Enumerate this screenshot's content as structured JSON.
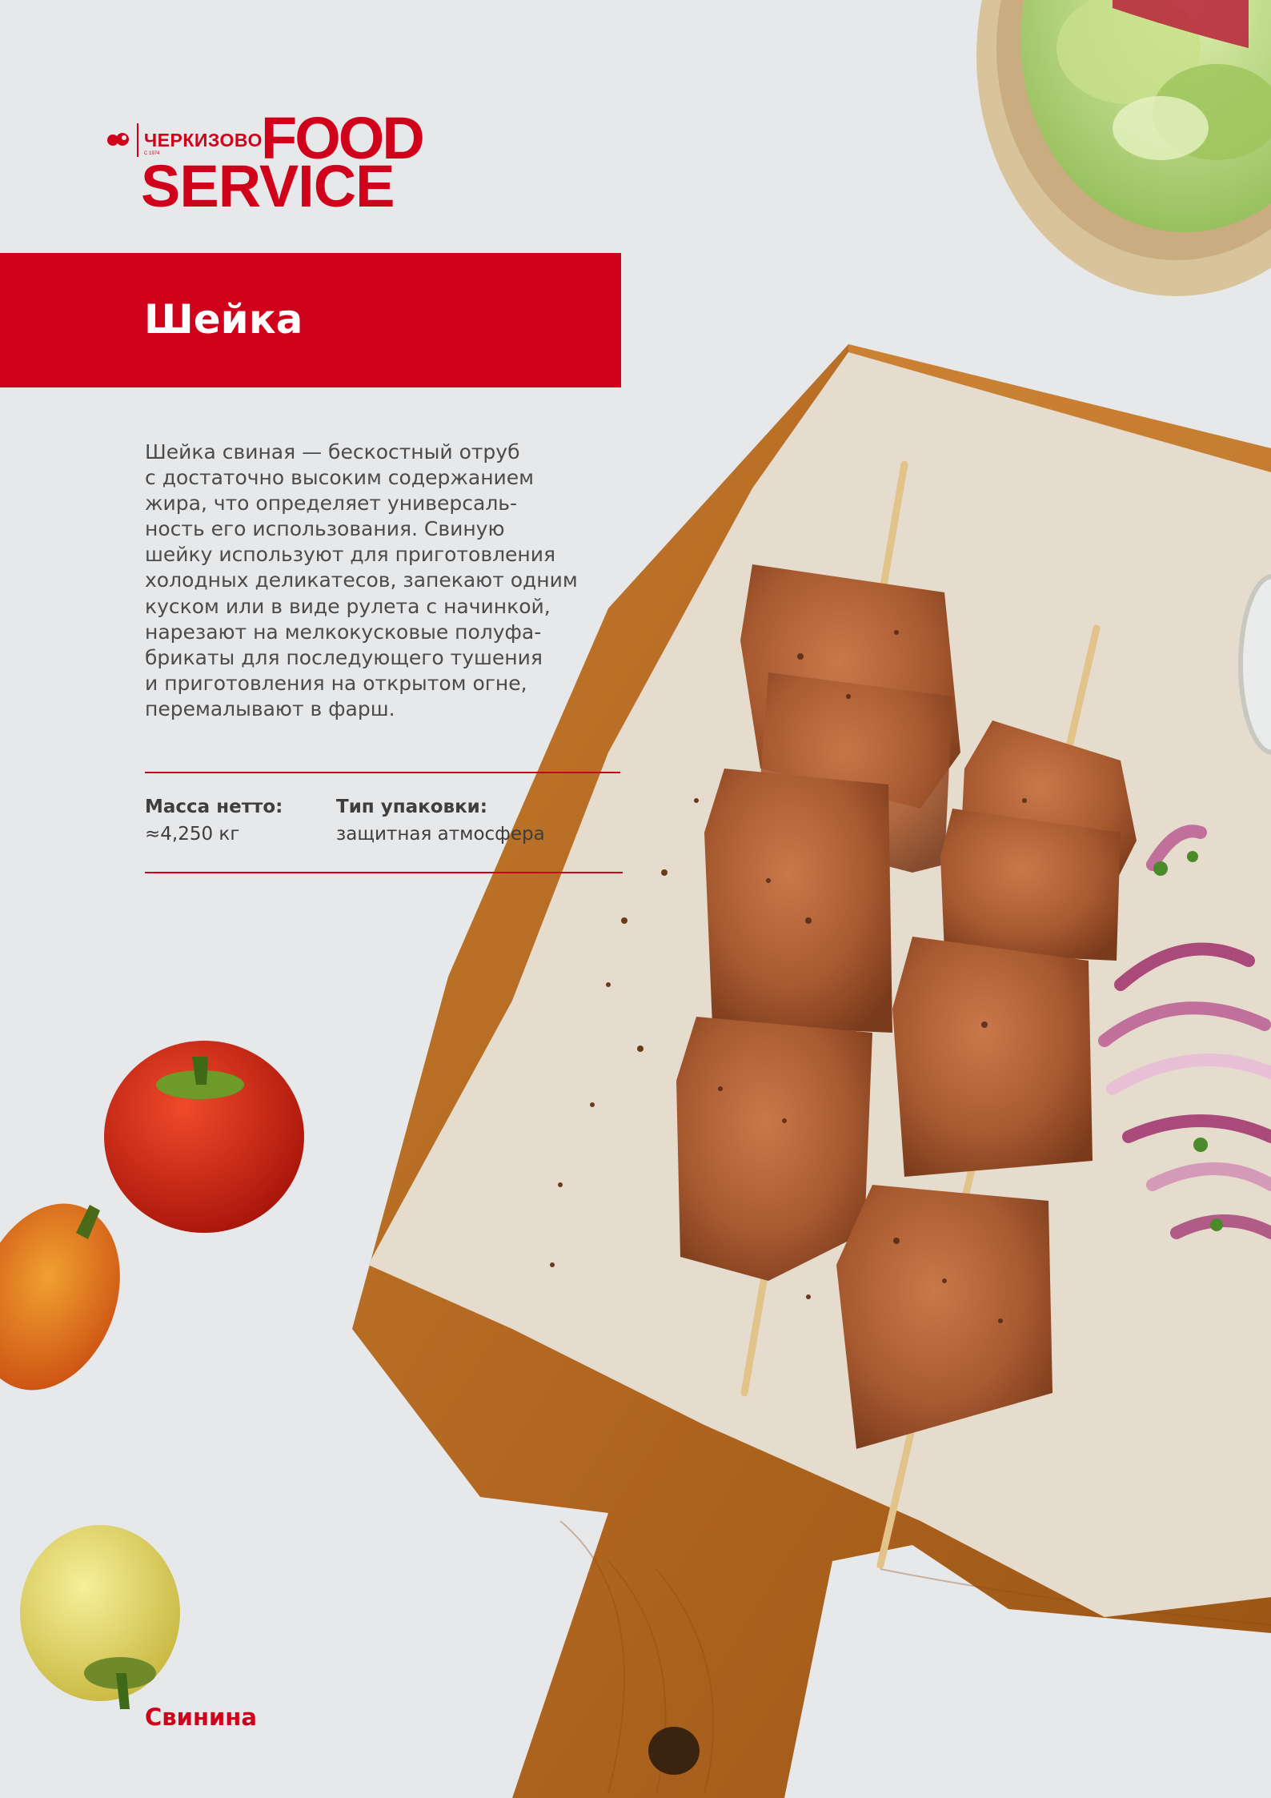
{
  "brand": {
    "company": "ЧЕРКИЗОВО",
    "since": "С 1974",
    "food": "FOOD",
    "service": "SERVICE",
    "color": "#d0021b"
  },
  "product": {
    "title": "Шейка",
    "description": "Шейка свиная — бескостный отруб\nс достаточно высоким содержанием\nжира, что определяет универсаль-\nность его использования. Свиную\nшейку используют для приготовления\nхолодных деликатесов, запекают одним\nкуском или в виде рулета с начинкой,\nнарезают на мелкокусковые полуфа-\nбрикаты для последующего тушения\nи приготовления на открытом огне,\nперемалывают в фарш."
  },
  "specs": {
    "weight": {
      "label": "Масса нетто:",
      "value": "≈4,250 кг"
    },
    "packaging": {
      "label": "Тип упаковки:",
      "value": "защитная атмосфера"
    }
  },
  "category": "Свинина",
  "images": {
    "photo": "pork-neck-skewers-on-cutting-board-photo",
    "salad": "green-salad-bowl",
    "peppers": [
      "red-pepper",
      "orange-pepper",
      "yellow-pepper"
    ],
    "onion": "red-onion-rings"
  }
}
